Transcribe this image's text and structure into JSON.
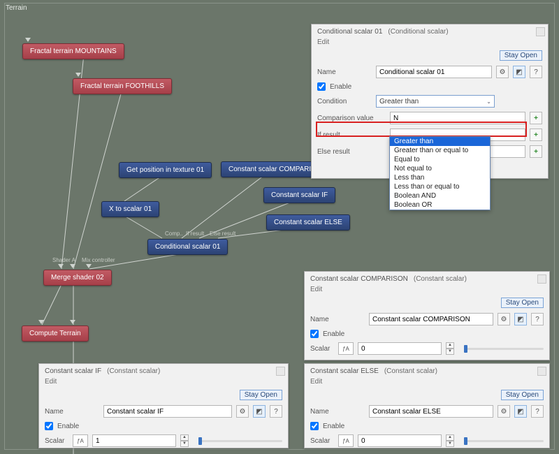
{
  "canvas": {
    "title": "Terrain"
  },
  "nodes": {
    "mountains": "Fractal terrain MOUNTAINS",
    "foothills": "Fractal terrain FOOTHILLS",
    "getpos": "Get position in texture 01",
    "x2scalar": "X to scalar 01",
    "condscalar": "Conditional scalar 01",
    "constcmp": "Constant scalar COMPARI..",
    "constif": "Constant scalar IF",
    "constelse": "Constant scalar ELSE",
    "merge": "Merge shader 02",
    "compute": "Compute Terrain"
  },
  "port_labels": {
    "comp": "Comp..",
    "ifres": "If result",
    "elseres": "Else result",
    "shaderA": "Shader A",
    "mixctl": "Mix controller"
  },
  "panel_cond": {
    "title_primary": "Conditional scalar 01",
    "title_secondary": "(Conditional scalar)",
    "edit": "Edit",
    "stayopen": "Stay Open",
    "name_label": "Name",
    "name_value": "Conditional scalar 01",
    "enable_label": "Enable",
    "enable_checked": true,
    "condition_label": "Condition",
    "condition_value": "Greater than",
    "compval_label": "Comparison value",
    "compval_value": "N",
    "ifres_label": "If result",
    "elseres_label": "Else result",
    "options": [
      "Greater than",
      "Greater than or equal to",
      "Equal to",
      "Not equal to",
      "Less than",
      "Less than or equal to",
      "Boolean AND",
      "Boolean OR"
    ]
  },
  "panel_cmp": {
    "title_primary": "Constant scalar COMPARISON",
    "title_secondary": "(Constant scalar)",
    "edit": "Edit",
    "stayopen": "Stay Open",
    "name_label": "Name",
    "name_value": "Constant scalar COMPARISON",
    "enable_label": "Enable",
    "enable_checked": true,
    "scalar_label": "Scalar",
    "scalar_value": "0"
  },
  "panel_if": {
    "title_primary": "Constant scalar IF",
    "title_secondary": "(Constant scalar)",
    "edit": "Edit",
    "stayopen": "Stay Open",
    "name_label": "Name",
    "name_value": "Constant scalar IF",
    "enable_label": "Enable",
    "enable_checked": true,
    "scalar_label": "Scalar",
    "scalar_value": "1"
  },
  "panel_else": {
    "title_primary": "Constant scalar ELSE",
    "title_secondary": "(Constant scalar)",
    "edit": "Edit",
    "stayopen": "Stay Open",
    "name_label": "Name",
    "name_value": "Constant scalar ELSE",
    "enable_label": "Enable",
    "enable_checked": true,
    "scalar_label": "Scalar",
    "scalar_value": "0"
  },
  "icons": {
    "gear": "⚙",
    "info": "◩",
    "help": "?",
    "plus": "+",
    "up": "▲",
    "down": "▼",
    "chev": "⌄",
    "fx": "ƒA"
  }
}
